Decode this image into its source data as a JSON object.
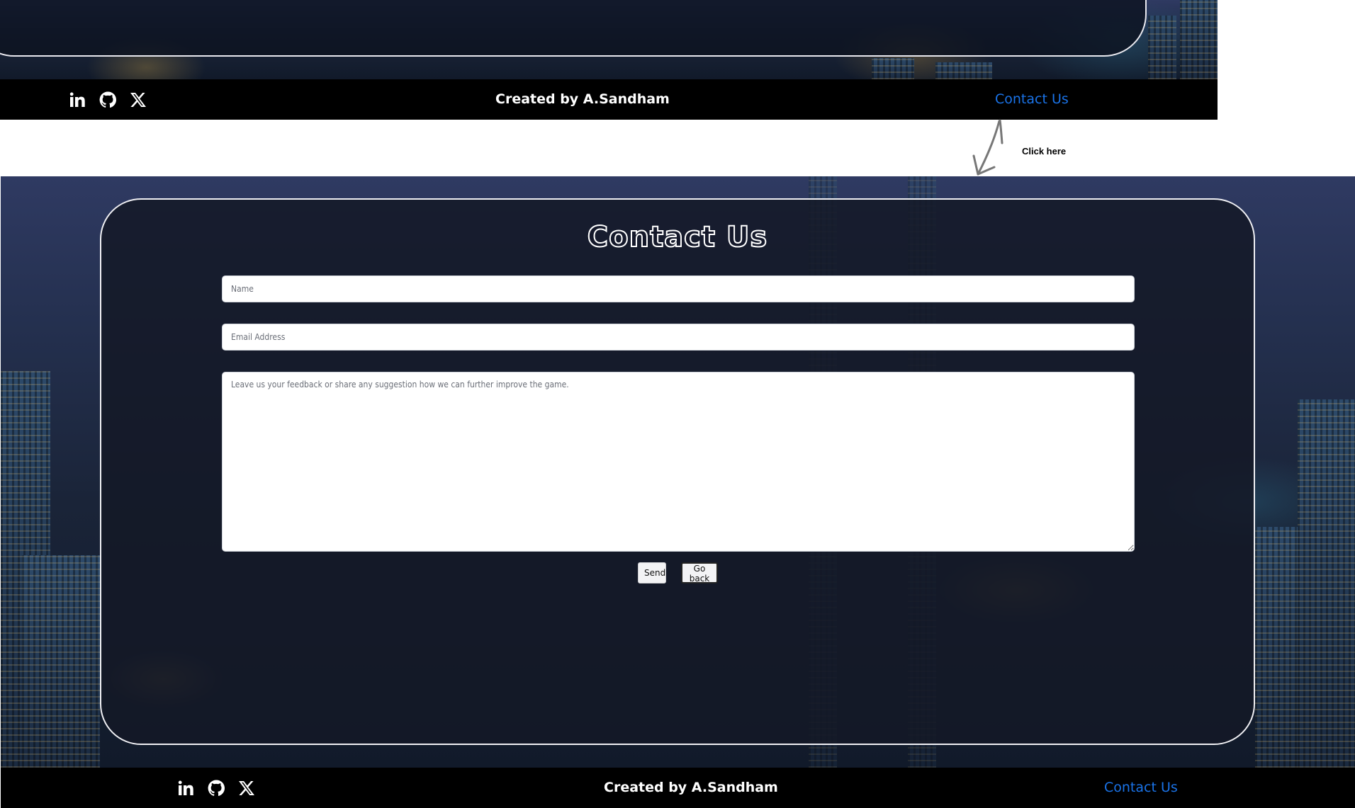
{
  "top_screenshot": {
    "footer": {
      "social_icons": [
        "linkedin-icon",
        "github-icon",
        "x-twitter-icon"
      ],
      "credit": "Created by A.Sandham",
      "contact_link": "Contact Us"
    }
  },
  "annotation": {
    "note": "Click here"
  },
  "contact_page": {
    "title": "Contact Us",
    "form": {
      "name_placeholder": "Name",
      "email_placeholder": "Email Address",
      "feedback_placeholder": "Leave us your feedback or share any suggestion how we can further improve the game.",
      "send_label": "Send",
      "goback_label": "Go back"
    },
    "footer": {
      "social_icons": [
        "linkedin-icon",
        "github-icon",
        "x-twitter-icon"
      ],
      "credit": "Created by A.Sandham",
      "contact_link": "Contact Us"
    }
  },
  "colors": {
    "footer_bg": "#000000",
    "link": "#1a73e8",
    "panel_border": "#f0f0f4"
  }
}
